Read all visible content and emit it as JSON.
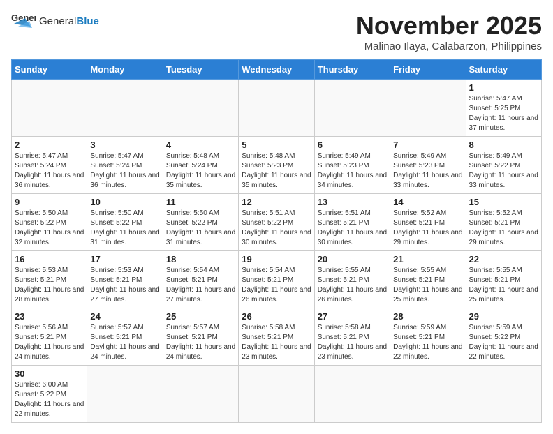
{
  "header": {
    "logo_general": "General",
    "logo_blue": "Blue",
    "month_title": "November 2025",
    "location": "Malinao Ilaya, Calabarzon, Philippines"
  },
  "weekdays": [
    "Sunday",
    "Monday",
    "Tuesday",
    "Wednesday",
    "Thursday",
    "Friday",
    "Saturday"
  ],
  "days": [
    {
      "num": "",
      "info": ""
    },
    {
      "num": "",
      "info": ""
    },
    {
      "num": "",
      "info": ""
    },
    {
      "num": "",
      "info": ""
    },
    {
      "num": "",
      "info": ""
    },
    {
      "num": "",
      "info": ""
    },
    {
      "num": "1",
      "info": "Sunrise: 5:47 AM\nSunset: 5:25 PM\nDaylight: 11 hours and 37 minutes."
    },
    {
      "num": "2",
      "info": "Sunrise: 5:47 AM\nSunset: 5:24 PM\nDaylight: 11 hours and 36 minutes."
    },
    {
      "num": "3",
      "info": "Sunrise: 5:47 AM\nSunset: 5:24 PM\nDaylight: 11 hours and 36 minutes."
    },
    {
      "num": "4",
      "info": "Sunrise: 5:48 AM\nSunset: 5:24 PM\nDaylight: 11 hours and 35 minutes."
    },
    {
      "num": "5",
      "info": "Sunrise: 5:48 AM\nSunset: 5:23 PM\nDaylight: 11 hours and 35 minutes."
    },
    {
      "num": "6",
      "info": "Sunrise: 5:49 AM\nSunset: 5:23 PM\nDaylight: 11 hours and 34 minutes."
    },
    {
      "num": "7",
      "info": "Sunrise: 5:49 AM\nSunset: 5:23 PM\nDaylight: 11 hours and 33 minutes."
    },
    {
      "num": "8",
      "info": "Sunrise: 5:49 AM\nSunset: 5:22 PM\nDaylight: 11 hours and 33 minutes."
    },
    {
      "num": "9",
      "info": "Sunrise: 5:50 AM\nSunset: 5:22 PM\nDaylight: 11 hours and 32 minutes."
    },
    {
      "num": "10",
      "info": "Sunrise: 5:50 AM\nSunset: 5:22 PM\nDaylight: 11 hours and 31 minutes."
    },
    {
      "num": "11",
      "info": "Sunrise: 5:50 AM\nSunset: 5:22 PM\nDaylight: 11 hours and 31 minutes."
    },
    {
      "num": "12",
      "info": "Sunrise: 5:51 AM\nSunset: 5:22 PM\nDaylight: 11 hours and 30 minutes."
    },
    {
      "num": "13",
      "info": "Sunrise: 5:51 AM\nSunset: 5:21 PM\nDaylight: 11 hours and 30 minutes."
    },
    {
      "num": "14",
      "info": "Sunrise: 5:52 AM\nSunset: 5:21 PM\nDaylight: 11 hours and 29 minutes."
    },
    {
      "num": "15",
      "info": "Sunrise: 5:52 AM\nSunset: 5:21 PM\nDaylight: 11 hours and 29 minutes."
    },
    {
      "num": "16",
      "info": "Sunrise: 5:53 AM\nSunset: 5:21 PM\nDaylight: 11 hours and 28 minutes."
    },
    {
      "num": "17",
      "info": "Sunrise: 5:53 AM\nSunset: 5:21 PM\nDaylight: 11 hours and 27 minutes."
    },
    {
      "num": "18",
      "info": "Sunrise: 5:54 AM\nSunset: 5:21 PM\nDaylight: 11 hours and 27 minutes."
    },
    {
      "num": "19",
      "info": "Sunrise: 5:54 AM\nSunset: 5:21 PM\nDaylight: 11 hours and 26 minutes."
    },
    {
      "num": "20",
      "info": "Sunrise: 5:55 AM\nSunset: 5:21 PM\nDaylight: 11 hours and 26 minutes."
    },
    {
      "num": "21",
      "info": "Sunrise: 5:55 AM\nSunset: 5:21 PM\nDaylight: 11 hours and 25 minutes."
    },
    {
      "num": "22",
      "info": "Sunrise: 5:55 AM\nSunset: 5:21 PM\nDaylight: 11 hours and 25 minutes."
    },
    {
      "num": "23",
      "info": "Sunrise: 5:56 AM\nSunset: 5:21 PM\nDaylight: 11 hours and 24 minutes."
    },
    {
      "num": "24",
      "info": "Sunrise: 5:57 AM\nSunset: 5:21 PM\nDaylight: 11 hours and 24 minutes."
    },
    {
      "num": "25",
      "info": "Sunrise: 5:57 AM\nSunset: 5:21 PM\nDaylight: 11 hours and 24 minutes."
    },
    {
      "num": "26",
      "info": "Sunrise: 5:58 AM\nSunset: 5:21 PM\nDaylight: 11 hours and 23 minutes."
    },
    {
      "num": "27",
      "info": "Sunrise: 5:58 AM\nSunset: 5:21 PM\nDaylight: 11 hours and 23 minutes."
    },
    {
      "num": "28",
      "info": "Sunrise: 5:59 AM\nSunset: 5:21 PM\nDaylight: 11 hours and 22 minutes."
    },
    {
      "num": "29",
      "info": "Sunrise: 5:59 AM\nSunset: 5:22 PM\nDaylight: 11 hours and 22 minutes."
    },
    {
      "num": "30",
      "info": "Sunrise: 6:00 AM\nSunset: 5:22 PM\nDaylight: 11 hours and 22 minutes."
    },
    {
      "num": "",
      "info": ""
    },
    {
      "num": "",
      "info": ""
    },
    {
      "num": "",
      "info": ""
    },
    {
      "num": "",
      "info": ""
    },
    {
      "num": "",
      "info": ""
    },
    {
      "num": "",
      "info": ""
    }
  ]
}
